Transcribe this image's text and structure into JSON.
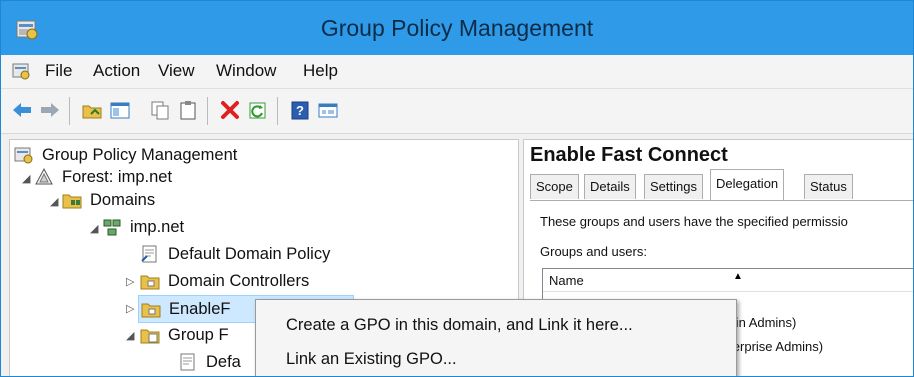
{
  "window": {
    "title": "Group Policy Management"
  },
  "menubar": {
    "items": [
      "File",
      "Action",
      "View",
      "Window",
      "Help"
    ]
  },
  "toolbar": {
    "buttons": [
      "back-icon",
      "forward-icon",
      "up-folder-icon",
      "show-hide-tree-icon",
      "copy-icon",
      "paste-icon",
      "delete-icon",
      "refresh-icon",
      "help-icon",
      "properties-icon"
    ]
  },
  "tree": {
    "root": "Group Policy Management",
    "forest": "Forest: imp.net",
    "domains": "Domains",
    "domain": "imp.net",
    "default_policy": "Default Domain Policy",
    "domain_controllers": "Domain Controllers",
    "selected_ou": "EnableF",
    "group_policy": "Group F",
    "default_child": "Defa"
  },
  "context_menu": {
    "items": [
      "Create a GPO in this domain, and Link it here...",
      "Link an Existing GPO..."
    ]
  },
  "details": {
    "title": "Enable Fast Connect",
    "tabs": [
      "Scope",
      "Details",
      "Settings",
      "Delegation",
      "Status"
    ],
    "active_tab": "Delegation",
    "description": "These groups and users have the specified permissio",
    "groups_label": "Groups and users:",
    "list_header_name": "Name",
    "rows": [
      "Domain Admins)",
      "P\\Enterprise Admins)"
    ]
  }
}
